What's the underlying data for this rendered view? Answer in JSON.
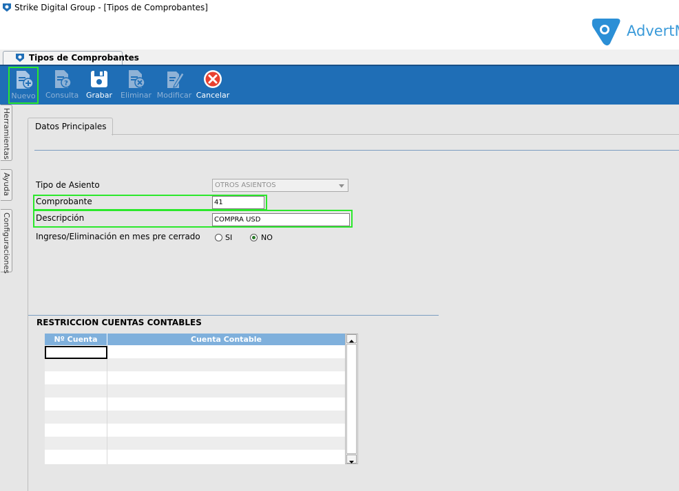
{
  "window": {
    "title": "Strike Digital Group - [Tipos de Comprobantes]",
    "brand_text": "AdvertM"
  },
  "document_tab": {
    "label": "Tipos de Comprobantes"
  },
  "toolbar": {
    "buttons": [
      {
        "label": "Nuevo",
        "enabled": true,
        "icon": "new-document-icon"
      },
      {
        "label": "Consulta",
        "enabled": false,
        "icon": "query-document-icon"
      },
      {
        "label": "Grabar",
        "enabled": true,
        "icon": "save-disk-icon"
      },
      {
        "label": "Eliminar",
        "enabled": false,
        "icon": "delete-document-icon"
      },
      {
        "label": "Modificar",
        "enabled": false,
        "icon": "edit-pencil-icon"
      },
      {
        "label": "Cancelar",
        "enabled": true,
        "icon": "cancel-x-icon"
      }
    ]
  },
  "side_tabs": [
    "Herramientas",
    "Ayuda",
    "Configuraciones"
  ],
  "form_tab": {
    "label": "Datos Principales"
  },
  "form": {
    "tipo_asiento": {
      "label": "Tipo de Asiento",
      "value": "OTROS ASIENTOS"
    },
    "comprobante": {
      "label": "Comprobante",
      "value": "41"
    },
    "descripcion": {
      "label": "Descripción",
      "value": "COMPRA USD"
    },
    "ingreso": {
      "label": "Ingreso/Eliminación en mes pre cerrado",
      "options": [
        "SI",
        "NO"
      ],
      "selected": "NO"
    }
  },
  "restricciones": {
    "title": "RESTRICCION CUENTAS CONTABLES",
    "columns": [
      "Nº Cuenta",
      "Cuenta Contable"
    ],
    "rows": []
  },
  "colors": {
    "toolbar_bg": "#1f6eb6",
    "highlight": "#2be82b",
    "grid_header": "#7fb0dc",
    "brand": "#3a9ad9"
  }
}
